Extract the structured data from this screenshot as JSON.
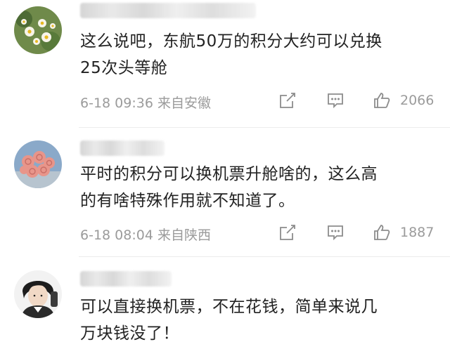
{
  "comments": [
    {
      "text_lines": [
        "这么说吧，东航50万的积分大约可以兑换",
        "25次头等舱"
      ],
      "time": "6-18 09:36",
      "location": "来自安徽",
      "likes": "2066",
      "avatar": "daisy-flowers-avatar"
    },
    {
      "text_lines": [
        "平时的积分可以换机票升舱啥的，这么高",
        "的有啥特殊作用就不知道了。"
      ],
      "time": "6-18 08:04",
      "location": "来自陕西",
      "likes": "1887",
      "avatar": "pink-roses-avatar"
    },
    {
      "text_lines": [
        "可以直接换机票，不在花钱，简单来说几",
        "万块钱没了！"
      ],
      "avatar": "person-portrait-avatar"
    }
  ],
  "icons": {
    "share": "share-icon",
    "comment": "comment-icon",
    "like": "thumbs-up-icon"
  }
}
